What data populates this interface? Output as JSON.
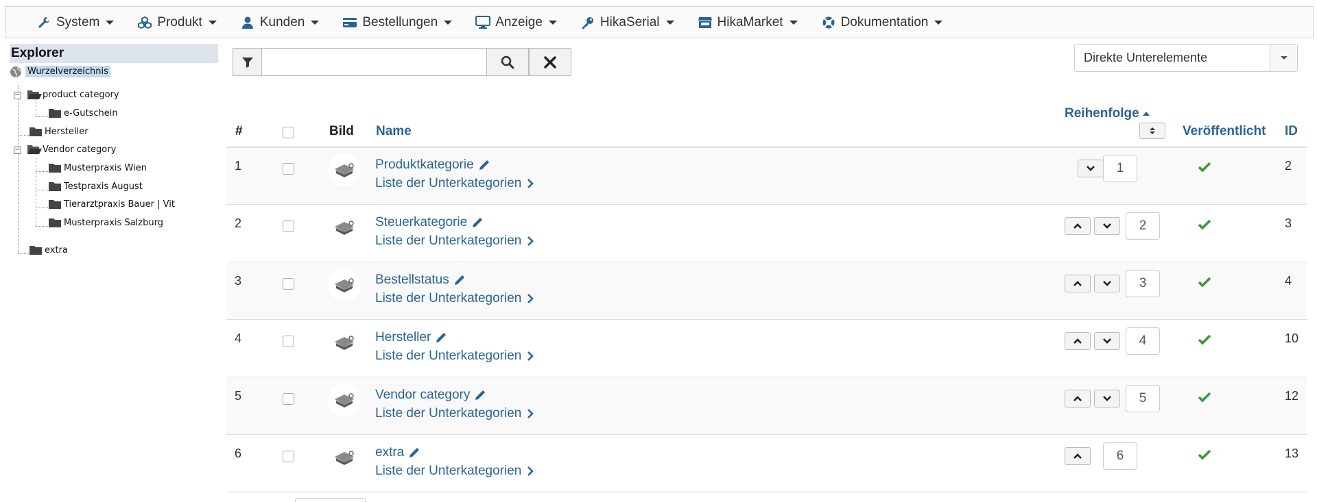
{
  "menu": [
    {
      "label": "System",
      "icon": "wrench-icon"
    },
    {
      "label": "Produkt",
      "icon": "cubes-icon"
    },
    {
      "label": "Kunden",
      "icon": "user-icon"
    },
    {
      "label": "Bestellungen",
      "icon": "credit-card-icon"
    },
    {
      "label": "Anzeige",
      "icon": "monitor-icon"
    },
    {
      "label": "HikaSerial",
      "icon": "key-icon"
    },
    {
      "label": "HikaMarket",
      "icon": "store-icon"
    },
    {
      "label": "Dokumentation",
      "icon": "lifebuoy-icon"
    }
  ],
  "explorer": {
    "title": "Explorer",
    "root": "Wurzelverzeichnis",
    "nodes": [
      "product category",
      "e-Gutschein",
      "Hersteller",
      "Vendor category",
      "Musterpraxis Wien",
      "Testpraxis August",
      "Tierarztpraxis Bauer | Vit",
      "Musterpraxis Salzburg",
      "extra"
    ]
  },
  "filter": {
    "search_placeholder": "",
    "scope_select": "Direkte Unterelemente"
  },
  "table": {
    "headers": {
      "num": "#",
      "image": "Bild",
      "name": "Name",
      "ordering": "Reihenfolge",
      "published": "Veröffentlicht",
      "id": "ID"
    },
    "sub_link_label": "Liste der Unterkategorien",
    "rows": [
      {
        "num": "1",
        "name": "Produktkategorie",
        "order": "1",
        "id": "2",
        "published": true
      },
      {
        "num": "2",
        "name": "Steuerkategorie",
        "order": "2",
        "id": "3",
        "published": true
      },
      {
        "num": "3",
        "name": "Bestellstatus",
        "order": "3",
        "id": "4",
        "published": true
      },
      {
        "num": "4",
        "name": "Hersteller",
        "order": "4",
        "id": "10",
        "published": true
      },
      {
        "num": "5",
        "name": "Vendor category",
        "order": "5",
        "id": "12",
        "published": true
      },
      {
        "num": "6",
        "name": "extra",
        "order": "6",
        "id": "13",
        "published": true
      }
    ]
  },
  "colors": {
    "link": "#2a6496",
    "published_check": "#3a9a3a",
    "root_highlight": "#c5d7ef"
  }
}
